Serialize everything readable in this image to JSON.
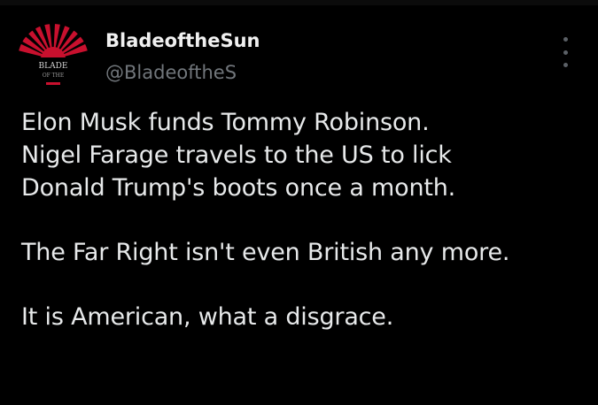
{
  "colors": {
    "background": "#000000",
    "text": "#e7e9ea",
    "secondary_text": "#71767b",
    "avatar_red": "#c8102e"
  },
  "author": {
    "display_name": "BladeoftheSun",
    "handle": "@BladeoftheS",
    "avatar_text_line1": "BLADE",
    "avatar_text_line2": "OF THE"
  },
  "menu": {
    "icon": "more-vertical-icon"
  },
  "tweet": {
    "lines": [
      "Elon Musk funds Tommy Robinson.",
      "Nigel Farage travels to the US to lick",
      "Donald Trump's boots once a month.",
      "The Far Right isn't even British any more.",
      "It is American, what a disgrace."
    ]
  }
}
